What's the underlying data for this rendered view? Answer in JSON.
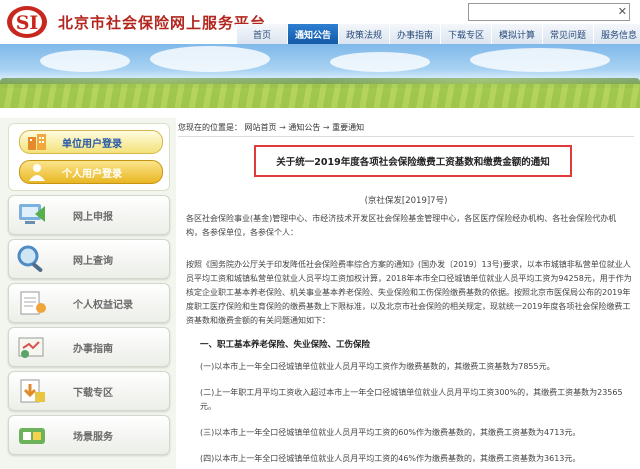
{
  "header": {
    "site_title": "北京市社会保险网上服务平台",
    "logo_icon": "si-logo-icon",
    "search_close": "✕",
    "brand_color": "#b3261e"
  },
  "nav": {
    "items": [
      "首页",
      "通知公告",
      "政策法规",
      "办事指南",
      "下载专区",
      "模拟计算",
      "常见问题",
      "服务信息"
    ],
    "active_index": 1
  },
  "sidebar": {
    "unit_login": "单位用户登录",
    "person_login": "个人用户登录",
    "menu": [
      {
        "label": "网上申报",
        "icon": "online-declare-icon"
      },
      {
        "label": "网上查询",
        "icon": "magnifier-icon"
      },
      {
        "label": "个人权益记录",
        "icon": "person-record-icon"
      },
      {
        "label": "办事指南",
        "icon": "guide-icon"
      },
      {
        "label": "下载专区",
        "icon": "download-icon"
      },
      {
        "label": "场景服务",
        "icon": "scene-service-icon"
      }
    ]
  },
  "breadcrumb": {
    "prefix": "您现在的位置是：",
    "items": [
      "网站首页",
      "通知公告",
      "重要通知"
    ],
    "sep": "→"
  },
  "article": {
    "title": "关于统一2019年度各项社会保险缴费工资基数和缴费金额的通知",
    "doc_no": "(京社保发[2019]7号)",
    "addressee": "各区社会保险事业(基金)管理中心、市经济技术开发区社会保险基金管理中心，各区医疗保险经办机构、各社会保险代办机构，各参保单位，各参保个人：",
    "body": "按照《国务院办公厅关于印发降低社会保险费率综合方案的通知》(国办发〔2019〕13号)要求，以本市城镇非私营单位就业人员平均工资和城镇私营单位就业人员平均工资加权计算，2018年本市全口径城镇单位就业人员平均工资为94258元，用于作为核定企业职工基本养老保险、机关事业基本养老保险、失业保险和工伤保险缴费基数的依据。按照北京市医保局公布的2019年度职工医疗保险和生育保险的缴费基数上下限标准，以及北京市社会保险的相关规定，现就统一2019年度各项社会保险缴费工资基数和缴费金额的有关问题通知如下：",
    "section_heading": "一、职工基本养老保险、失业保险、工伤保险",
    "items": [
      "(一)以本市上一年全口径城镇单位就业人员月平均工资作为缴费基数的，其缴费工资基数为7855元。",
      "(二)上一年职工月平均工资收入超过本市上一年全口径城镇单位就业人员月平均工资300%的，其缴费工资基数为23565元。",
      "(三)以本市上一年全口径城镇单位就业人员月平均工资的60%作为缴费基数的，其缴费工资基数为4713元。",
      "(四)以本市上一年全口径城镇单位就业人员月平均工资的46%作为缴费基数的，其缴费工资基数为3613元。"
    ]
  }
}
